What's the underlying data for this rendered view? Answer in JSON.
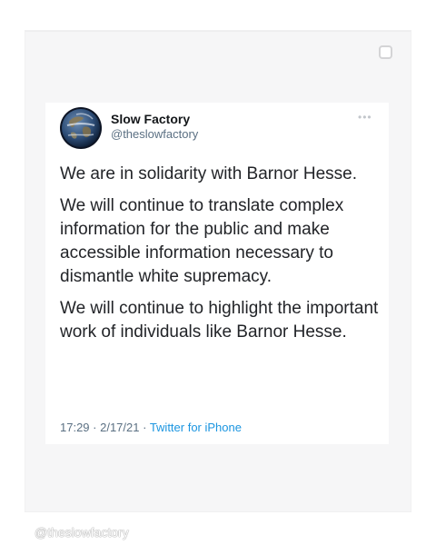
{
  "tweet": {
    "name": "Slow Factory",
    "handle": "@theslowfactory",
    "more": "•••",
    "paragraphs": [
      "We are in solidarity with Barnor Hesse.",
      "We will continue to translate complex information for the public and make accessible information necessary to dismantle white supremacy.",
      "We will continue to highlight the important work of individuals like Barnor Hesse."
    ],
    "time": "17:29",
    "date": "2/17/21",
    "separator": " · ",
    "source": "Twitter for iPhone"
  },
  "watermark": "@theslowfactory",
  "icons": {
    "avatar": "earth-globe-avatar",
    "corner": "square-outline-icon",
    "more": "more-options-icon"
  },
  "colors": {
    "name": "#14171a",
    "secondary": "#5b7083",
    "link": "#1b95e0",
    "panel": "#f6f6f7"
  }
}
